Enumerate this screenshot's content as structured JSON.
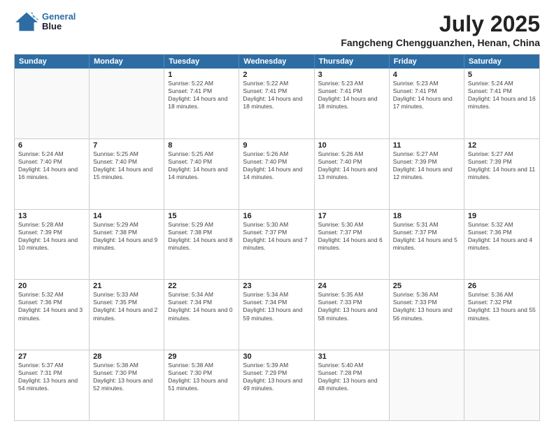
{
  "logo": {
    "line1": "General",
    "line2": "Blue"
  },
  "title": {
    "main": "July 2025",
    "sub": "Fangcheng Chengguanzhen, Henan, China"
  },
  "header_days": [
    "Sunday",
    "Monday",
    "Tuesday",
    "Wednesday",
    "Thursday",
    "Friday",
    "Saturday"
  ],
  "rows": [
    [
      {
        "day": "",
        "info": ""
      },
      {
        "day": "",
        "info": ""
      },
      {
        "day": "1",
        "info": "Sunrise: 5:22 AM\nSunset: 7:41 PM\nDaylight: 14 hours and 18 minutes."
      },
      {
        "day": "2",
        "info": "Sunrise: 5:22 AM\nSunset: 7:41 PM\nDaylight: 14 hours and 18 minutes."
      },
      {
        "day": "3",
        "info": "Sunrise: 5:23 AM\nSunset: 7:41 PM\nDaylight: 14 hours and 18 minutes."
      },
      {
        "day": "4",
        "info": "Sunrise: 5:23 AM\nSunset: 7:41 PM\nDaylight: 14 hours and 17 minutes."
      },
      {
        "day": "5",
        "info": "Sunrise: 5:24 AM\nSunset: 7:41 PM\nDaylight: 14 hours and 16 minutes."
      }
    ],
    [
      {
        "day": "6",
        "info": "Sunrise: 5:24 AM\nSunset: 7:40 PM\nDaylight: 14 hours and 16 minutes."
      },
      {
        "day": "7",
        "info": "Sunrise: 5:25 AM\nSunset: 7:40 PM\nDaylight: 14 hours and 15 minutes."
      },
      {
        "day": "8",
        "info": "Sunrise: 5:25 AM\nSunset: 7:40 PM\nDaylight: 14 hours and 14 minutes."
      },
      {
        "day": "9",
        "info": "Sunrise: 5:26 AM\nSunset: 7:40 PM\nDaylight: 14 hours and 14 minutes."
      },
      {
        "day": "10",
        "info": "Sunrise: 5:26 AM\nSunset: 7:40 PM\nDaylight: 14 hours and 13 minutes."
      },
      {
        "day": "11",
        "info": "Sunrise: 5:27 AM\nSunset: 7:39 PM\nDaylight: 14 hours and 12 minutes."
      },
      {
        "day": "12",
        "info": "Sunrise: 5:27 AM\nSunset: 7:39 PM\nDaylight: 14 hours and 11 minutes."
      }
    ],
    [
      {
        "day": "13",
        "info": "Sunrise: 5:28 AM\nSunset: 7:39 PM\nDaylight: 14 hours and 10 minutes."
      },
      {
        "day": "14",
        "info": "Sunrise: 5:29 AM\nSunset: 7:38 PM\nDaylight: 14 hours and 9 minutes."
      },
      {
        "day": "15",
        "info": "Sunrise: 5:29 AM\nSunset: 7:38 PM\nDaylight: 14 hours and 8 minutes."
      },
      {
        "day": "16",
        "info": "Sunrise: 5:30 AM\nSunset: 7:37 PM\nDaylight: 14 hours and 7 minutes."
      },
      {
        "day": "17",
        "info": "Sunrise: 5:30 AM\nSunset: 7:37 PM\nDaylight: 14 hours and 6 minutes."
      },
      {
        "day": "18",
        "info": "Sunrise: 5:31 AM\nSunset: 7:37 PM\nDaylight: 14 hours and 5 minutes."
      },
      {
        "day": "19",
        "info": "Sunrise: 5:32 AM\nSunset: 7:36 PM\nDaylight: 14 hours and 4 minutes."
      }
    ],
    [
      {
        "day": "20",
        "info": "Sunrise: 5:32 AM\nSunset: 7:36 PM\nDaylight: 14 hours and 3 minutes."
      },
      {
        "day": "21",
        "info": "Sunrise: 5:33 AM\nSunset: 7:35 PM\nDaylight: 14 hours and 2 minutes."
      },
      {
        "day": "22",
        "info": "Sunrise: 5:34 AM\nSunset: 7:34 PM\nDaylight: 14 hours and 0 minutes."
      },
      {
        "day": "23",
        "info": "Sunrise: 5:34 AM\nSunset: 7:34 PM\nDaylight: 13 hours and 59 minutes."
      },
      {
        "day": "24",
        "info": "Sunrise: 5:35 AM\nSunset: 7:33 PM\nDaylight: 13 hours and 58 minutes."
      },
      {
        "day": "25",
        "info": "Sunrise: 5:36 AM\nSunset: 7:33 PM\nDaylight: 13 hours and 56 minutes."
      },
      {
        "day": "26",
        "info": "Sunrise: 5:36 AM\nSunset: 7:32 PM\nDaylight: 13 hours and 55 minutes."
      }
    ],
    [
      {
        "day": "27",
        "info": "Sunrise: 5:37 AM\nSunset: 7:31 PM\nDaylight: 13 hours and 54 minutes."
      },
      {
        "day": "28",
        "info": "Sunrise: 5:38 AM\nSunset: 7:30 PM\nDaylight: 13 hours and 52 minutes."
      },
      {
        "day": "29",
        "info": "Sunrise: 5:38 AM\nSunset: 7:30 PM\nDaylight: 13 hours and 51 minutes."
      },
      {
        "day": "30",
        "info": "Sunrise: 5:39 AM\nSunset: 7:29 PM\nDaylight: 13 hours and 49 minutes."
      },
      {
        "day": "31",
        "info": "Sunrise: 5:40 AM\nSunset: 7:28 PM\nDaylight: 13 hours and 48 minutes."
      },
      {
        "day": "",
        "info": ""
      },
      {
        "day": "",
        "info": ""
      }
    ]
  ]
}
